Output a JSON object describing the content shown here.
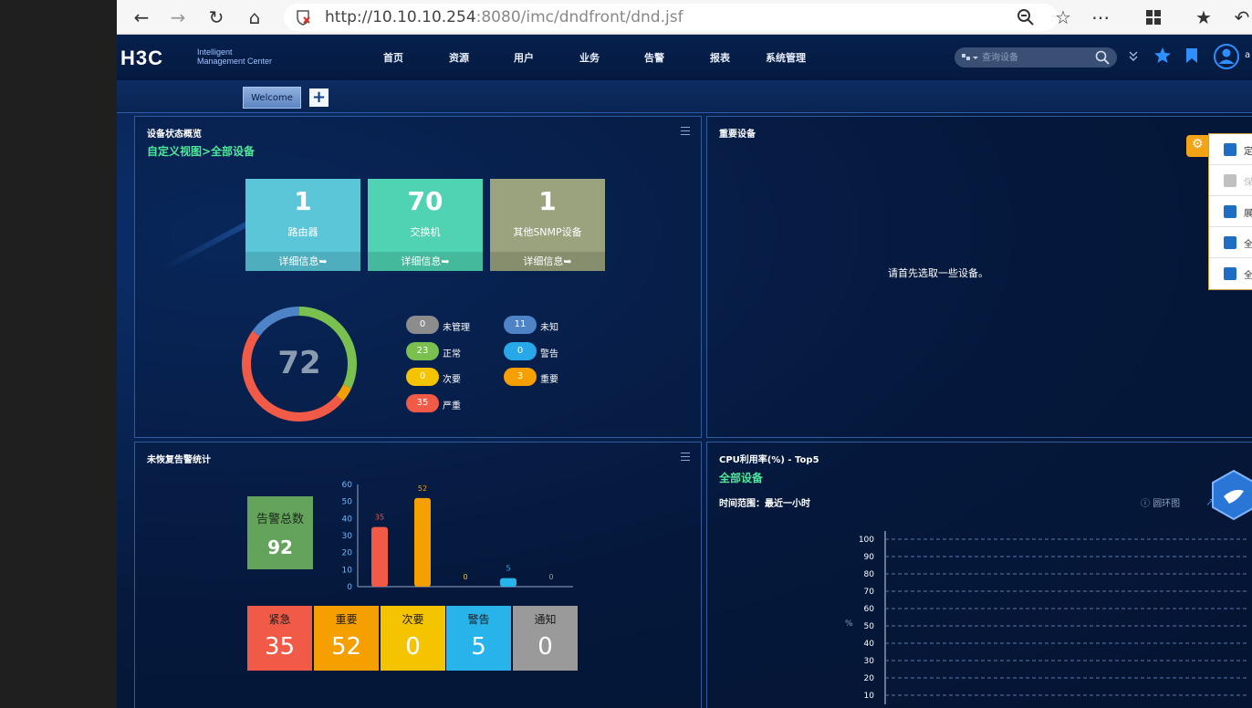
{
  "browser": {
    "url_host": "http://10.10.10.254",
    "url_rest": ":8080/imc/dndfront/dnd.jsf"
  },
  "header": {
    "logo": "H3C",
    "logo_sub_1": "Intelligent",
    "logo_sub_2": "Management Center",
    "nav": [
      "首页",
      "资源",
      "用户",
      "业务",
      "告警",
      "报表",
      "系统管理"
    ],
    "search_placeholder": "查询设备",
    "user_initial": "a"
  },
  "tabs": {
    "welcome": "Welcome",
    "add": "+"
  },
  "device_overview": {
    "title": "设备状态概览",
    "subtitle": "自定义视图>全部设备",
    "cards": [
      {
        "value": "1",
        "label": "路由器",
        "link": "详细信息",
        "color": "#5bc6d8"
      },
      {
        "value": "70",
        "label": "交换机",
        "link": "详细信息",
        "color": "#4fd3b2"
      },
      {
        "value": "1",
        "label": "其他SNMP设备",
        "link": "详细信息",
        "color": "#9aa27e"
      }
    ],
    "total": "72",
    "legend": [
      {
        "count": "0",
        "label": "未管理",
        "color": "#8c8c8c"
      },
      {
        "count": "11",
        "label": "未知",
        "color": "#4f83c8"
      },
      {
        "count": "23",
        "label": "正常",
        "color": "#7ac04f"
      },
      {
        "count": "0",
        "label": "警告",
        "color": "#28a8e8"
      },
      {
        "count": "0",
        "label": "次要",
        "color": "#f5c400"
      },
      {
        "count": "3",
        "label": "重要",
        "color": "#f5a000"
      },
      {
        "count": "35",
        "label": "严重",
        "color": "#f05a46"
      }
    ],
    "ring": {
      "total": 72,
      "unknown": 11,
      "normal": 23,
      "major": 3,
      "critical": 35
    }
  },
  "important_devices": {
    "title": "重要设备",
    "empty_msg": "请首先选取一些设备。"
  },
  "popmenu": {
    "items": [
      "定",
      "保",
      "展",
      "全",
      "全"
    ]
  },
  "alarm_stats": {
    "title": "未恢复告警统计",
    "total_label": "告警总数",
    "total_value": "92",
    "severities": [
      {
        "label": "紧急",
        "value": "35",
        "color": "#f05a46"
      },
      {
        "label": "重要",
        "value": "52",
        "color": "#f5a000"
      },
      {
        "label": "次要",
        "value": "0",
        "color": "#f5c400"
      },
      {
        "label": "警告",
        "value": "5",
        "color": "#28b4ea"
      },
      {
        "label": "通知",
        "value": "0",
        "color": "#9a9a9a"
      }
    ]
  },
  "chart_data": [
    {
      "type": "bar",
      "categories": [
        "紧急",
        "重要",
        "次要",
        "警告",
        "通知"
      ],
      "values": [
        35,
        52,
        0,
        5,
        0
      ],
      "colors": [
        "#f05a46",
        "#f5a000",
        "#f5c400",
        "#28b4ea",
        "#9a9a9a"
      ],
      "yticks": [
        "0",
        "10",
        "20",
        "30",
        "40",
        "50",
        "60"
      ],
      "ylim": [
        0,
        60
      ]
    },
    {
      "type": "line",
      "yticks": [
        "10",
        "20",
        "30",
        "40",
        "50",
        "60",
        "70",
        "80",
        "90",
        "100"
      ],
      "ylim": [
        0,
        100
      ]
    }
  ],
  "cpu": {
    "title": "CPU利用率(%) - Top5",
    "subtitle": "全部设备",
    "time_range": "时间范围：最近一小时",
    "ring_btn": "圆环图",
    "ylabel": "%"
  }
}
